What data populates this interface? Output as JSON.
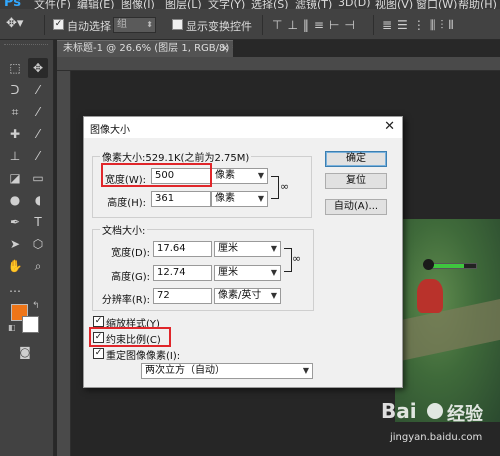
{
  "app": {
    "logo": "Ps",
    "menu": [
      "文件(F)",
      "编辑(E)",
      "图像(I)",
      "图层(L)",
      "文字(Y)",
      "选择(S)",
      "滤镜(T)",
      "3D(D)",
      "视图(V)",
      "窗口(W)",
      "帮助(H)"
    ]
  },
  "options_bar": {
    "auto_select_label": "自动选择：",
    "auto_select_checked": "✓",
    "auto_select_value": "组",
    "show_transform_label": "显示变换控件"
  },
  "document_tab": {
    "title": "未标题-1 @ 26.6% (图层 1, RGB/8) *",
    "close": "×"
  },
  "colors": {
    "foreground": "#ee7518",
    "background": "#ffffff",
    "highlight": "#e0262a"
  },
  "dialog": {
    "title": "图像大小",
    "close": "✕",
    "pixel_group": {
      "legend": "像素大小:529.1K(之前为2.75M)",
      "width_label": "宽度(W):",
      "width_value": "500",
      "width_unit": "像素",
      "height_label": "高度(H):",
      "height_value": "361",
      "height_unit": "像素"
    },
    "doc_group": {
      "legend": "文档大小:",
      "width_label": "宽度(D):",
      "width_value": "17.64",
      "width_unit": "厘米",
      "height_label": "高度(G):",
      "height_value": "12.74",
      "height_unit": "厘米",
      "resolution_label": "分辨率(R):",
      "resolution_value": "72",
      "resolution_unit": "像素/英寸"
    },
    "buttons": {
      "ok": "确定",
      "reset": "复位",
      "auto": "自动(A)..."
    },
    "checkboxes": {
      "scale_styles": "缩放样式(Y)",
      "constrain": "约束比例(C)",
      "resample": "重定图像像素(I):"
    },
    "check_mark": "✓",
    "resample_method": "两次立方（自动）"
  },
  "watermark": {
    "brand_left": "Bai",
    "brand_right": "经验",
    "url": "jingyan.baidu.com"
  }
}
